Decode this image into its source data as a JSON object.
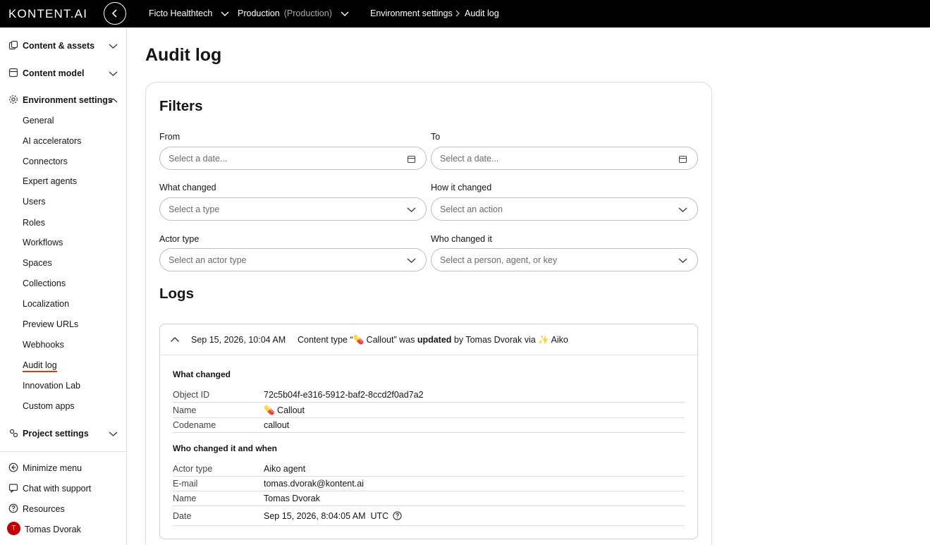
{
  "topbar": {
    "logo": "KONTENT.AI",
    "project": "Ficto Healthtech",
    "environment": "Production",
    "environment_suffix": "(Production)",
    "breadcrumb_parent": "Environment settings",
    "breadcrumb_current": "Audit log"
  },
  "sidebar": {
    "groups": {
      "content_assets": "Content & assets",
      "content_model": "Content model",
      "environment_settings": "Environment settings",
      "project_settings": "Project settings"
    },
    "env_items": [
      "General",
      "AI accelerators",
      "Connectors",
      "Expert agents",
      "Users",
      "Roles",
      "Workflows",
      "Spaces",
      "Collections",
      "Localization",
      "Preview URLs",
      "Webhooks",
      "Audit log",
      "Innovation Lab",
      "Custom apps"
    ],
    "active_item": "Audit log",
    "footer": {
      "minimize": "Minimize menu",
      "chat": "Chat with support",
      "resources": "Resources",
      "user_name": "Tomas Dvorak",
      "user_initial": "T"
    }
  },
  "main": {
    "title": "Audit log",
    "filters": {
      "heading": "Filters",
      "from_label": "From",
      "from_placeholder": "Select a date...",
      "to_label": "To",
      "to_placeholder": "Select a date...",
      "what_label": "What changed",
      "what_placeholder": "Select a type",
      "how_label": "How it changed",
      "how_placeholder": "Select an action",
      "actor_label": "Actor type",
      "actor_placeholder": "Select an actor type",
      "who_label": "Who changed it",
      "who_placeholder": "Select a person, agent, or key"
    },
    "logs": {
      "heading": "Logs",
      "entry": {
        "date": "Sep 15, 2026, 10:04 AM",
        "summary_prefix": "Content type “💊 Callout” was ",
        "summary_action": "updated",
        "summary_suffix": " by Tomas Dvorak via ✨ Aiko",
        "what_title": "What changed",
        "what_rows": [
          {
            "key": "Object ID",
            "value": "72c5b04f-e316-5912-baf2-8ccd2f0ad7a2"
          },
          {
            "key": "Name",
            "value": "💊 Callout"
          },
          {
            "key": "Codename",
            "value": "callout"
          }
        ],
        "who_title": "Who changed it and when",
        "who_rows": [
          {
            "key": "Actor type",
            "value": "Aiko agent"
          },
          {
            "key": "E-mail",
            "value": "tomas.dvorak@kontent.ai"
          },
          {
            "key": "Name",
            "value": "Tomas Dvorak"
          },
          {
            "key": "Date",
            "value": "Sep 15, 2026, 8:04:05 AM  UTC"
          }
        ]
      }
    }
  },
  "colors": {
    "topbar_bg": "#000000",
    "active_underline": "#db3c00",
    "avatar_bg": "#c00000"
  }
}
